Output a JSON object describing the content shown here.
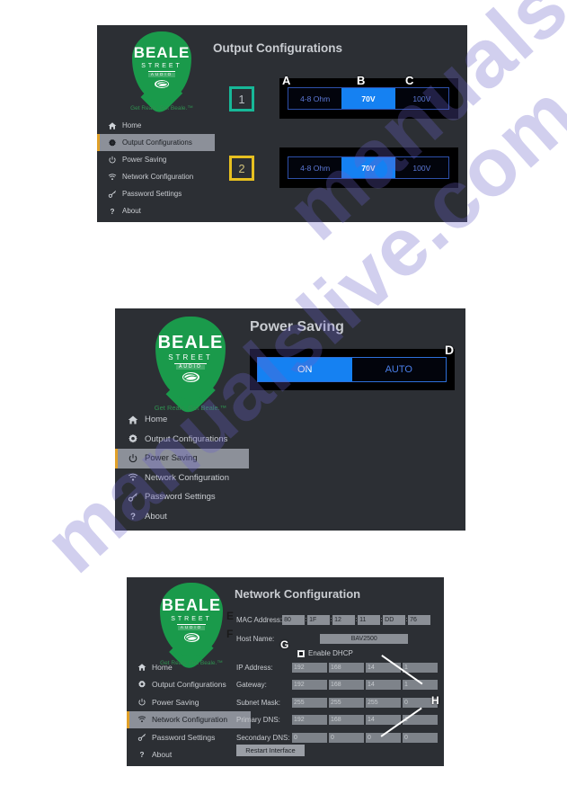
{
  "watermark": {
    "text": "manualslive.com"
  },
  "brand": {
    "name_line1": "BEALE",
    "name_line2": "STREET",
    "name_line3": "AUDIO",
    "tagline": "Get Reals. Get Beale.™",
    "swirl_icon": "swirl-logo-icon",
    "green": "#1a9a4b"
  },
  "nav": {
    "items": [
      {
        "label": "Home",
        "icon": "home-icon"
      },
      {
        "label": "Output Configurations",
        "icon": "gear-icon"
      },
      {
        "label": "Power Saving",
        "icon": "power-icon"
      },
      {
        "label": "Network Configuration",
        "icon": "wifi-icon"
      },
      {
        "label": "Password Settings",
        "icon": "key-icon"
      },
      {
        "label": "About",
        "icon": "question-icon"
      }
    ]
  },
  "panel_output": {
    "title": "Output Configurations",
    "active_nav_index": 1,
    "channels": [
      {
        "badge": "1",
        "badge_color": "#17b898",
        "options": [
          "4-8 Ohm",
          "70V",
          "100V"
        ],
        "selected": "70V"
      },
      {
        "badge": "2",
        "badge_color": "#e7c020",
        "options": [
          "4-8 Ohm",
          "70V",
          "100V"
        ],
        "selected": "70V"
      }
    ],
    "callouts": [
      {
        "letter": "A",
        "target": "4-8 Ohm option"
      },
      {
        "letter": "B",
        "target": "70V option"
      },
      {
        "letter": "C",
        "target": "100V option"
      }
    ]
  },
  "panel_power": {
    "title": "Power Saving",
    "active_nav_index": 2,
    "options": [
      "ON",
      "AUTO"
    ],
    "selected": "ON",
    "callouts": [
      {
        "letter": "D",
        "target": "power saving toggle"
      }
    ]
  },
  "panel_network": {
    "title": "Network Configuration",
    "active_nav_index": 3,
    "mac_label": "MAC Address:",
    "mac_octets": [
      "80",
      "1F",
      "12",
      "11",
      "DD",
      "76"
    ],
    "host_label": "Host Name:",
    "host_value": "BAV2500",
    "dhcp_label": "Enable DHCP",
    "dhcp_checked": true,
    "fields": [
      {
        "label": "IP Address:",
        "values": [
          "192",
          "168",
          "14",
          "1"
        ]
      },
      {
        "label": "Gateway:",
        "values": [
          "192",
          "168",
          "14",
          "1"
        ]
      },
      {
        "label": "Subnet Mask:",
        "values": [
          "255",
          "255",
          "255",
          "0"
        ]
      },
      {
        "label": "Primary DNS:",
        "values": [
          "192",
          "168",
          "14",
          "1"
        ]
      },
      {
        "label": "Secondary DNS:",
        "values": [
          "0",
          "0",
          "0",
          "0"
        ]
      }
    ],
    "restart_label": "Restart Interface",
    "callouts": [
      {
        "letter": "E",
        "target": "MAC address row"
      },
      {
        "letter": "F",
        "target": "host name row"
      },
      {
        "letter": "G",
        "target": "enable DHCP checkbox"
      },
      {
        "letter": "H",
        "target": "IP settings group"
      }
    ]
  }
}
